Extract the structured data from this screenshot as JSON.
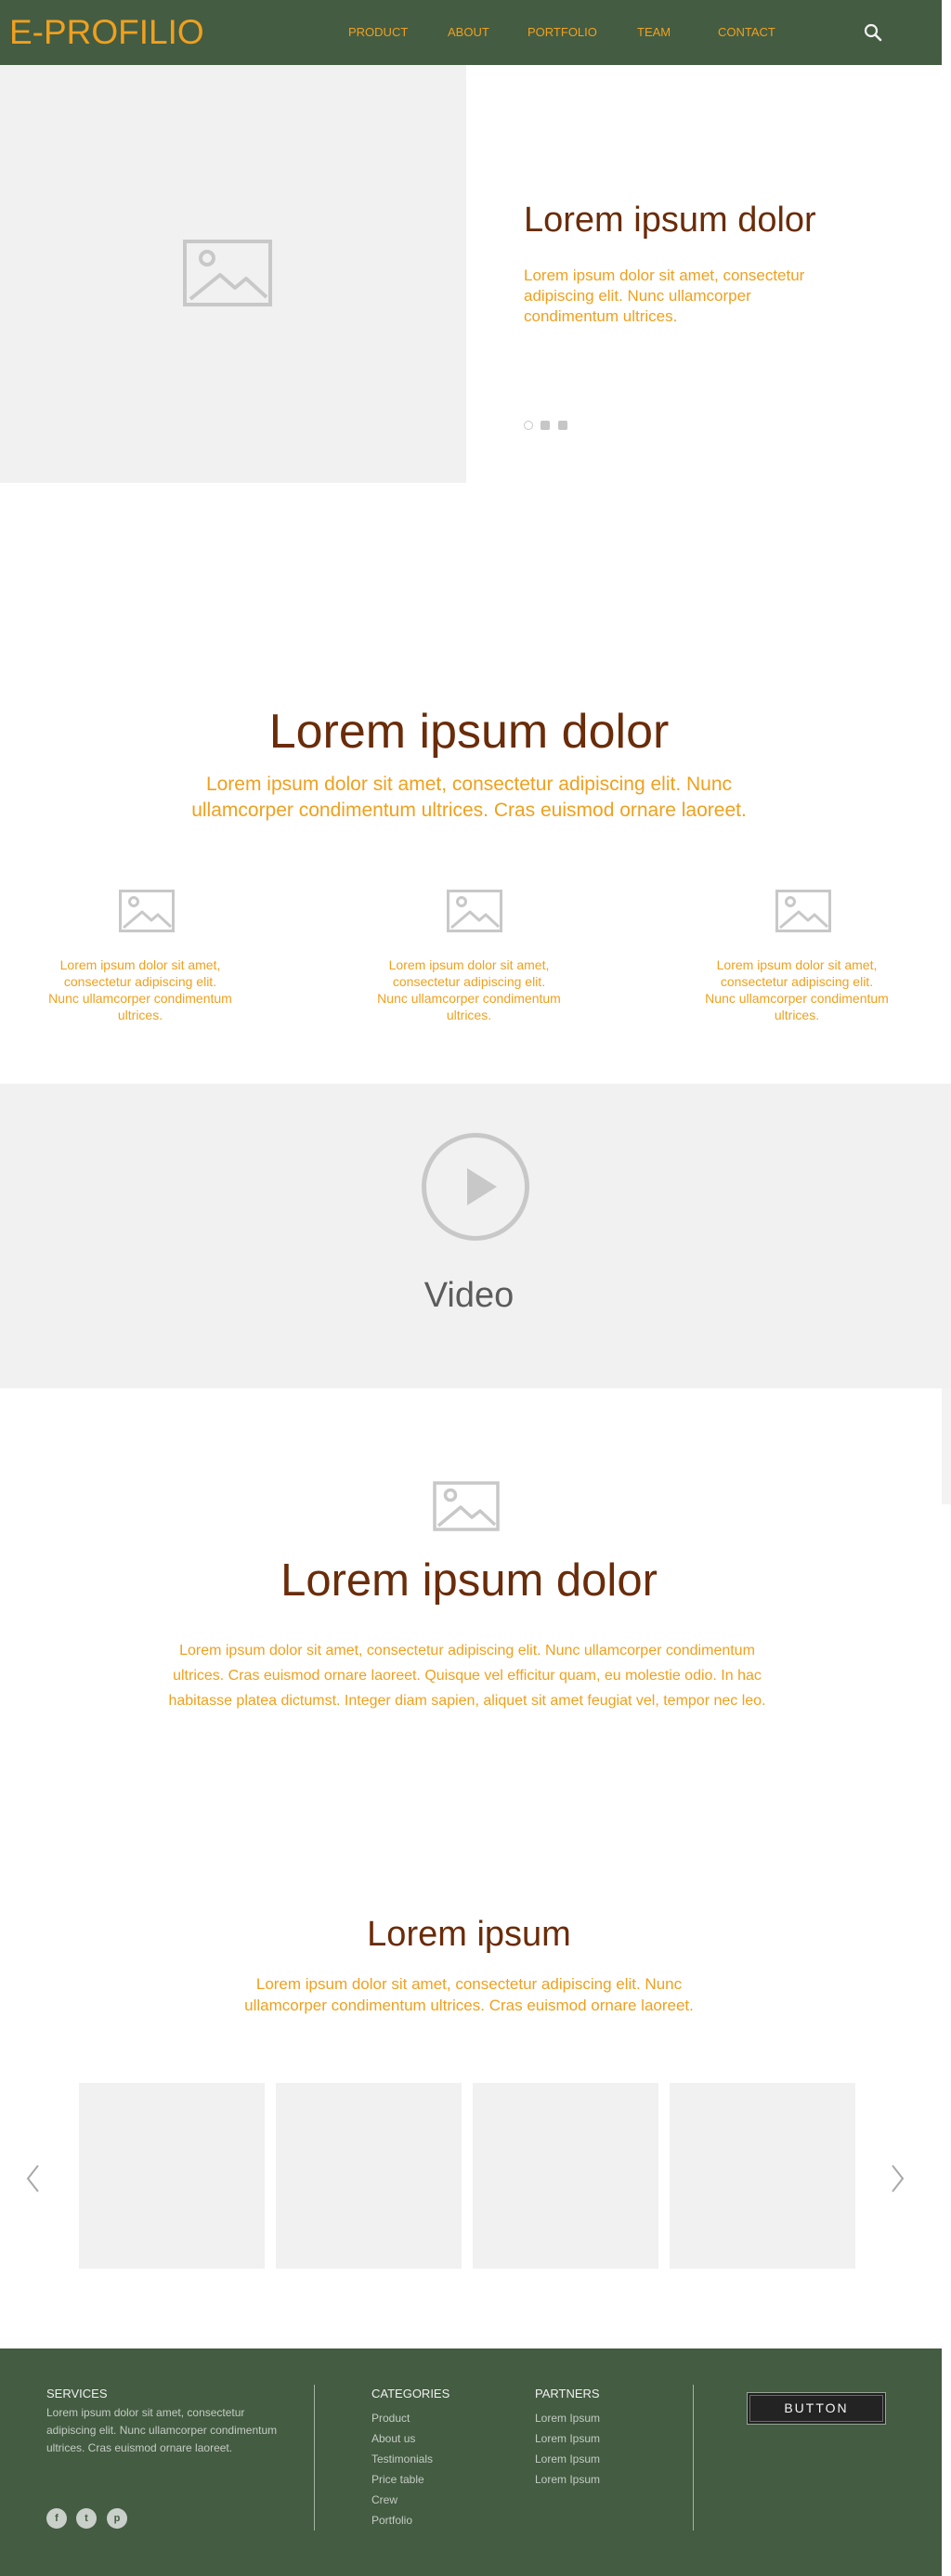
{
  "header": {
    "logo": "E-PROFILIO",
    "nav": [
      "PRODUCT",
      "ABOUT",
      "PORTFOLIO",
      "TEAM",
      "CONTACT"
    ],
    "search_icon": "search-icon"
  },
  "hero": {
    "image_icon": "image-placeholder-icon",
    "title": "Lorem ipsum dolor",
    "text": "Lorem ipsum dolor sit amet, consectetur adipiscing elit. Nunc ullamcorper condimentum ultrices.",
    "slider_dots": 3,
    "active_dot": 1
  },
  "features": {
    "title": "Lorem ipsum dolor",
    "subtitle": "Lorem ipsum dolor sit amet, consectetur adipiscing elit. Nunc ullamcorper condimentum ultrices. Cras euismod ornare laoreet.",
    "items": [
      {
        "icon": "image-placeholder-icon",
        "text": "Lorem ipsum dolor sit amet, consectetur adipiscing elit. Nunc ullamcorper condimentum ultrices."
      },
      {
        "icon": "image-placeholder-icon",
        "text": "Lorem ipsum dolor sit amet, consectetur adipiscing elit. Nunc ullamcorper condimentum ultrices."
      },
      {
        "icon": "image-placeholder-icon",
        "text": "Lorem ipsum dolor sit amet, consectetur adipiscing elit. Nunc ullamcorper condimentum ultrices."
      }
    ]
  },
  "video": {
    "icon": "play-icon",
    "label": "Video"
  },
  "about": {
    "icon": "image-placeholder-icon",
    "title": "Lorem ipsum dolor",
    "text": "Lorem ipsum dolor sit amet, consectetur adipiscing elit. Nunc ullamcorper condimentum ultrices. Cras euismod ornare laoreet. Quisque vel efficitur quam, eu molestie odio. In hac habitasse platea dictumst. Integer diam sapien, aliquet sit amet feugiat vel, tempor nec leo."
  },
  "gallery": {
    "title": "Lorem ipsum",
    "subtitle": "Lorem ipsum dolor sit amet, consectetur adipiscing elit. Nunc ullamcorper condimentum ultrices. Cras euismod ornare laoreet.",
    "items": 4,
    "prev_icon": "chevron-left-icon",
    "next_icon": "chevron-right-icon"
  },
  "footer": {
    "services": {
      "heading": "SERVICES",
      "text": "Lorem ipsum dolor sit amet, consectetur adipiscing elit. Nunc ullamcorper condimentum ultrices. Cras euismod ornare laoreet."
    },
    "social": [
      {
        "icon": "facebook-icon",
        "glyph": "f"
      },
      {
        "icon": "twitter-icon",
        "glyph": "t"
      },
      {
        "icon": "pinterest-icon",
        "glyph": "p"
      }
    ],
    "categories": {
      "heading": "CATEGORIES",
      "links": [
        "Product",
        "About us",
        "Testimonials",
        "Price table",
        "Crew",
        "Portfolio"
      ]
    },
    "partners": {
      "heading": "PARTNERS",
      "links": [
        "Lorem Ipsum",
        "Lorem Ipsum",
        "Lorem Ipsum",
        "Lorem Ipsum"
      ]
    },
    "button_label": "BUTTON"
  },
  "colors": {
    "header_bg": "#445c42",
    "accent_orange": "#f0a01e",
    "title_brown": "#6a2c09",
    "placeholder_gray": "#f1f1f1"
  }
}
